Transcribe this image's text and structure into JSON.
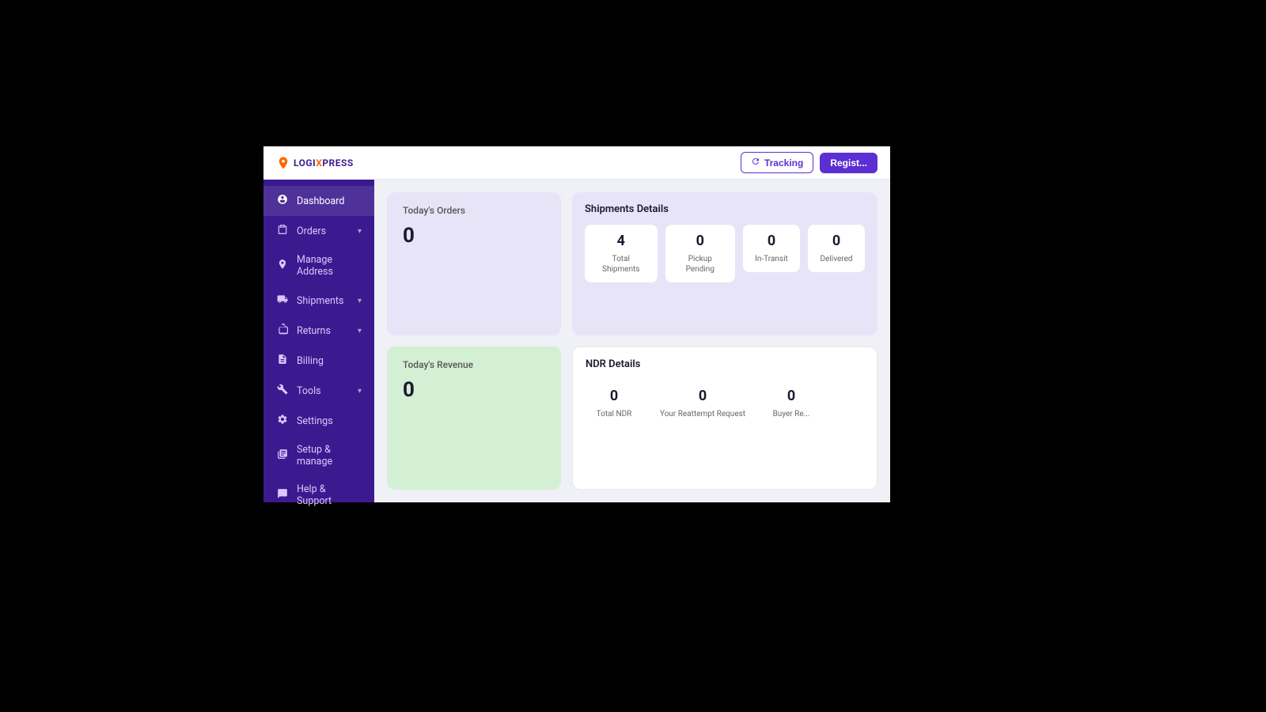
{
  "app": {
    "name": "LogiXpress"
  },
  "header": {
    "tracking_label": "Tracking",
    "register_label": "Regist..."
  },
  "sidebar": {
    "items": [
      {
        "id": "dashboard",
        "label": "Dashboard",
        "icon": "👤",
        "has_arrow": false
      },
      {
        "id": "orders",
        "label": "Orders",
        "icon": "🛒",
        "has_arrow": true
      },
      {
        "id": "manage-address",
        "label": "Manage Address",
        "icon": "📍",
        "has_arrow": false
      },
      {
        "id": "shipments",
        "label": "Shipments",
        "icon": "🚚",
        "has_arrow": true
      },
      {
        "id": "returns",
        "label": "Returns",
        "icon": "📋",
        "has_arrow": true
      },
      {
        "id": "billing",
        "label": "Billing",
        "icon": "📄",
        "has_arrow": false
      },
      {
        "id": "tools",
        "label": "Tools",
        "icon": "⚙",
        "has_arrow": true
      },
      {
        "id": "settings",
        "label": "Settings",
        "icon": "⚙️",
        "has_arrow": false
      },
      {
        "id": "setup-manage",
        "label": "Setup & manage",
        "icon": "📚",
        "has_arrow": false
      },
      {
        "id": "help-support",
        "label": "Help & Support",
        "icon": "🎧",
        "has_arrow": false
      }
    ]
  },
  "dashboard": {
    "todays_orders": {
      "title": "Today's Orders",
      "value": "0"
    },
    "todays_revenue": {
      "title": "Today's Revenue",
      "value": "0"
    },
    "shipments_details": {
      "title": "Shipments Details",
      "metrics": [
        {
          "label": "Total Shipments",
          "value": "4"
        },
        {
          "label": "Pickup Pending",
          "value": "0"
        },
        {
          "label": "In-Transit",
          "value": "0"
        },
        {
          "label": "Delivered",
          "value": "0"
        }
      ]
    },
    "ndr_details": {
      "title": "NDR Details",
      "metrics": [
        {
          "label": "Total NDR",
          "value": "0"
        },
        {
          "label": "Your Reattempt Request",
          "value": "0"
        },
        {
          "label": "Buyer Re...",
          "value": "0"
        }
      ]
    }
  }
}
